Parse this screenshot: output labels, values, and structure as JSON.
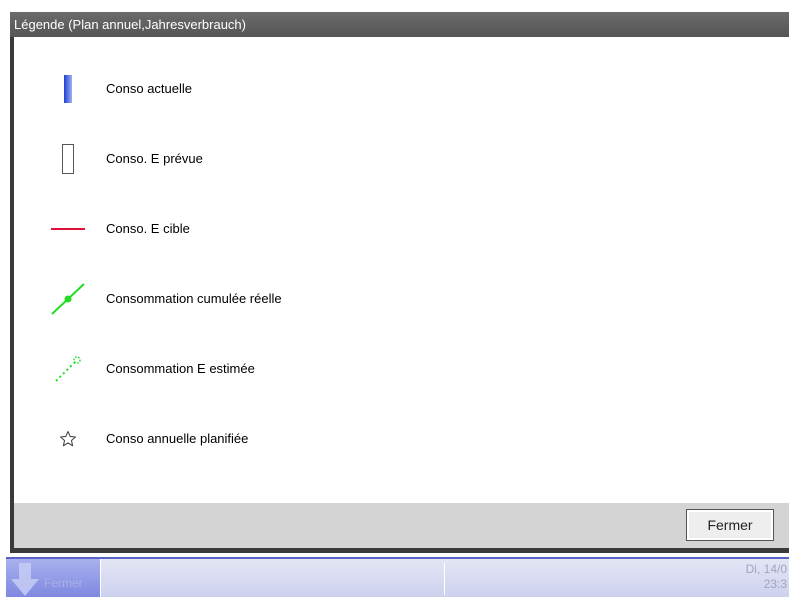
{
  "dialog": {
    "title": "Légende (Plan annuel,Jahresverbrauch)",
    "close_label": "Fermer"
  },
  "legend": {
    "items": [
      {
        "icon": "blue-bar-icon",
        "label": "Conso actuelle"
      },
      {
        "icon": "outline-bar-icon",
        "label": "Conso. E prévue"
      },
      {
        "icon": "red-line-icon",
        "label": "Conso. E cible"
      },
      {
        "icon": "green-line-icon",
        "label": "Consommation cumulée réelle"
      },
      {
        "icon": "green-dotted-line-icon",
        "label": "Consommation E estimée"
      },
      {
        "icon": "star-icon",
        "label": "Conso annuelle planifiée"
      }
    ],
    "colors": {
      "actual": "#3a5fe0",
      "target": "#e0103a",
      "cumulative": "#22dd22"
    }
  },
  "taskbar": {
    "button_label": "Fermer",
    "date": "Di, 14/0",
    "time": "23:3"
  }
}
